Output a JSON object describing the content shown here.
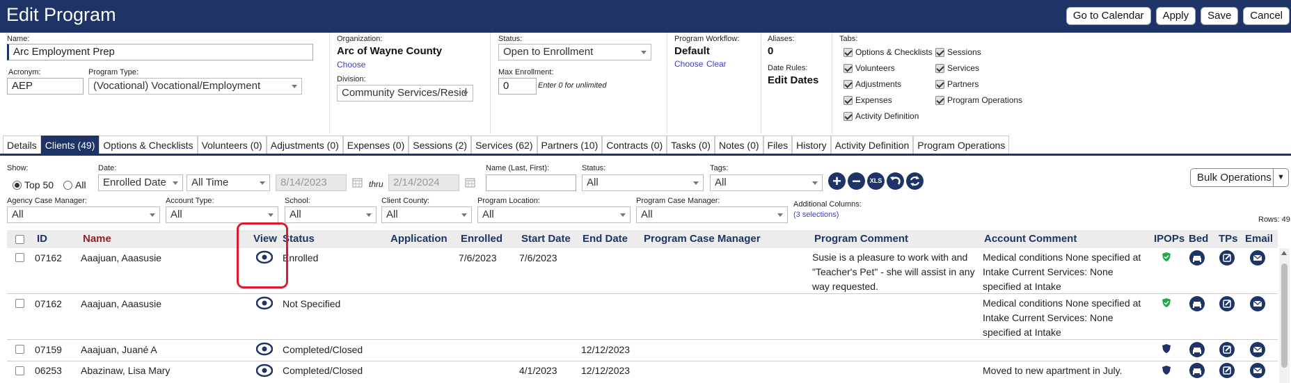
{
  "window": {
    "title": "Edit Program",
    "buttons": [
      "Go to Calendar",
      "Apply",
      "Save",
      "Cancel"
    ]
  },
  "form": {
    "name_label": "Name:",
    "name_value": "Arc Employment Prep",
    "acronym_label": "Acronym:",
    "acronym_value": "AEP",
    "program_type_label": "Program Type:",
    "program_type_value": "(Vocational) Vocational/Employment",
    "organization_label": "Organization:",
    "organization_value": "Arc of Wayne County",
    "organization_choose": "Choose",
    "division_label": "Division:",
    "division_value": "Community Services/Resid",
    "status_label": "Status:",
    "status_value": "Open to Enrollment",
    "max_enrollment_label": "Max Enrollment:",
    "max_enrollment_value": "0",
    "max_enrollment_hint": "Enter 0 for unlimited",
    "workflow_label": "Program Workflow:",
    "workflow_value": "Default",
    "workflow_choose": "Choose",
    "workflow_clear": "Clear",
    "aliases_label": "Aliases:",
    "aliases_value": "0",
    "date_rules_label": "Date Rules:",
    "date_rules_value": "Edit Dates",
    "tabs_label": "Tabs:",
    "tab_checks_col1": [
      "Options & Checklists",
      "Volunteers",
      "Adjustments",
      "Expenses",
      "Activity Definition"
    ],
    "tab_checks_col2": [
      "Sessions",
      "Services",
      "Partners",
      "Program Operations"
    ]
  },
  "tabs": [
    "Details",
    "Clients (49)",
    "Options & Checklists",
    "Volunteers (0)",
    "Adjustments (0)",
    "Expenses (0)",
    "Sessions (2)",
    "Services (62)",
    "Partners (10)",
    "Contracts (0)",
    "Tasks (0)",
    "Notes (0)",
    "Files",
    "History",
    "Activity Definition",
    "Program Operations"
  ],
  "filters": {
    "show_label": "Show:",
    "show_top": "Top 50",
    "show_all": "All",
    "date_label": "Date:",
    "date_field": "Enrolled Date",
    "date_range": "All Time",
    "date_from": "8/14/2023",
    "thru": "thru",
    "date_to": "2/14/2024",
    "name_label": "Name (Last, First):",
    "status_label": "Status:",
    "status_value": "All",
    "tags_label": "Tags:",
    "tags_value": "All",
    "xls_label": "XLS",
    "bulk_operations": "Bulk Operations",
    "agency_cm_label": "Agency Case Manager:",
    "agency_cm_value": "All",
    "account_type_label": "Account Type:",
    "account_type_value": "All",
    "school_label": "School:",
    "school_value": "All",
    "county_label": "Client County:",
    "county_value": "All",
    "location_label": "Program Location:",
    "location_value": "All",
    "pcm_label": "Program Case Manager:",
    "pcm_value": "All",
    "additional_columns_label": "Additional Columns:",
    "additional_columns_value": "(3 selections)",
    "rows_label": "Rows: 49"
  },
  "table": {
    "headers": {
      "id": "ID",
      "name": "Name",
      "view": "View",
      "status": "Status",
      "application": "Application",
      "enrolled": "Enrolled",
      "start_date": "Start Date",
      "end_date": "End Date",
      "pcm": "Program Case Manager",
      "program_comment": "Program Comment",
      "account_comment": "Account Comment",
      "ipops": "IPOPs",
      "bed": "Bed",
      "tps": "TPs",
      "email": "Email"
    },
    "rows": [
      {
        "id": "07162",
        "name": "Aaajuan, Aaasusie",
        "status": "Enrolled",
        "enrolled": "7/6/2023",
        "start": "7/6/2023",
        "end": "",
        "program_comment": "Susie is a pleasure to work with and \"Teacher's Pet\" - she will assist in any way requested.",
        "account_comment": "Medical conditions None specified at Intake Current Services: None specified at Intake"
      },
      {
        "id": "07162",
        "name": "Aaajuan, Aaasusie",
        "status": "Not Specified",
        "enrolled": "",
        "start": "",
        "end": "",
        "program_comment": "",
        "account_comment": "Medical conditions None specified at Intake Current Services: None specified at Intake"
      },
      {
        "id": "07159",
        "name": "Aaajuan, Juané A",
        "status": "Completed/Closed",
        "enrolled": "",
        "start": "",
        "end": "12/12/2023",
        "program_comment": "",
        "account_comment": ""
      },
      {
        "id": "06253",
        "name": "Abazinaw, Lisa Mary",
        "status": "Completed/Closed",
        "enrolled": "",
        "start": "4/1/2023",
        "end": "12/12/2023",
        "program_comment": "",
        "account_comment": "Moved to new apartment in July."
      }
    ]
  },
  "colors": {
    "navy": "#1e3466",
    "name_header": "#9b1c1c",
    "green_shield": "#22aa44",
    "highlight": "#e0182d"
  }
}
